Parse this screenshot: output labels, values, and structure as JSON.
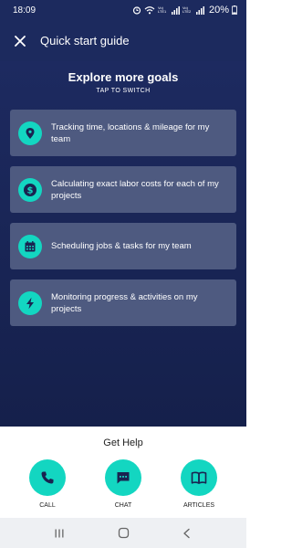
{
  "status_bar": {
    "time": "18:09",
    "network_label_1": "Vo) LTE1",
    "network_label_2": "Vo) LTE2",
    "battery": "20%",
    "icons": [
      "alarm-icon",
      "wifi-icon",
      "signal-icon",
      "battery-icon"
    ]
  },
  "header": {
    "close_icon": "close-icon",
    "title": "Quick start guide"
  },
  "goals": {
    "title": "Explore more goals",
    "subtitle": "TAP TO SWITCH",
    "items": [
      {
        "icon": "location-pin-icon",
        "label": "Tracking time, locations & mileage for my team"
      },
      {
        "icon": "dollar-icon",
        "label": "Calculating exact labor costs for each of my projects"
      },
      {
        "icon": "calendar-icon",
        "label": "Scheduling jobs & tasks for my team"
      },
      {
        "icon": "lightning-icon",
        "label": "Monitoring progress & activities on my projects"
      }
    ]
  },
  "help": {
    "title": "Get Help",
    "buttons": [
      {
        "icon": "phone-icon",
        "label": "CALL"
      },
      {
        "icon": "chat-icon",
        "label": "CHAT"
      },
      {
        "icon": "book-icon",
        "label": "ARTICLES"
      }
    ]
  },
  "nav_bar": {
    "icons": [
      "recent-apps-icon",
      "home-icon",
      "back-icon"
    ]
  },
  "colors": {
    "header_bg": "#1c2a5e",
    "card_bg": "#4e5a80",
    "accent": "#13d6c1",
    "nav_bg": "#eef0f3"
  }
}
